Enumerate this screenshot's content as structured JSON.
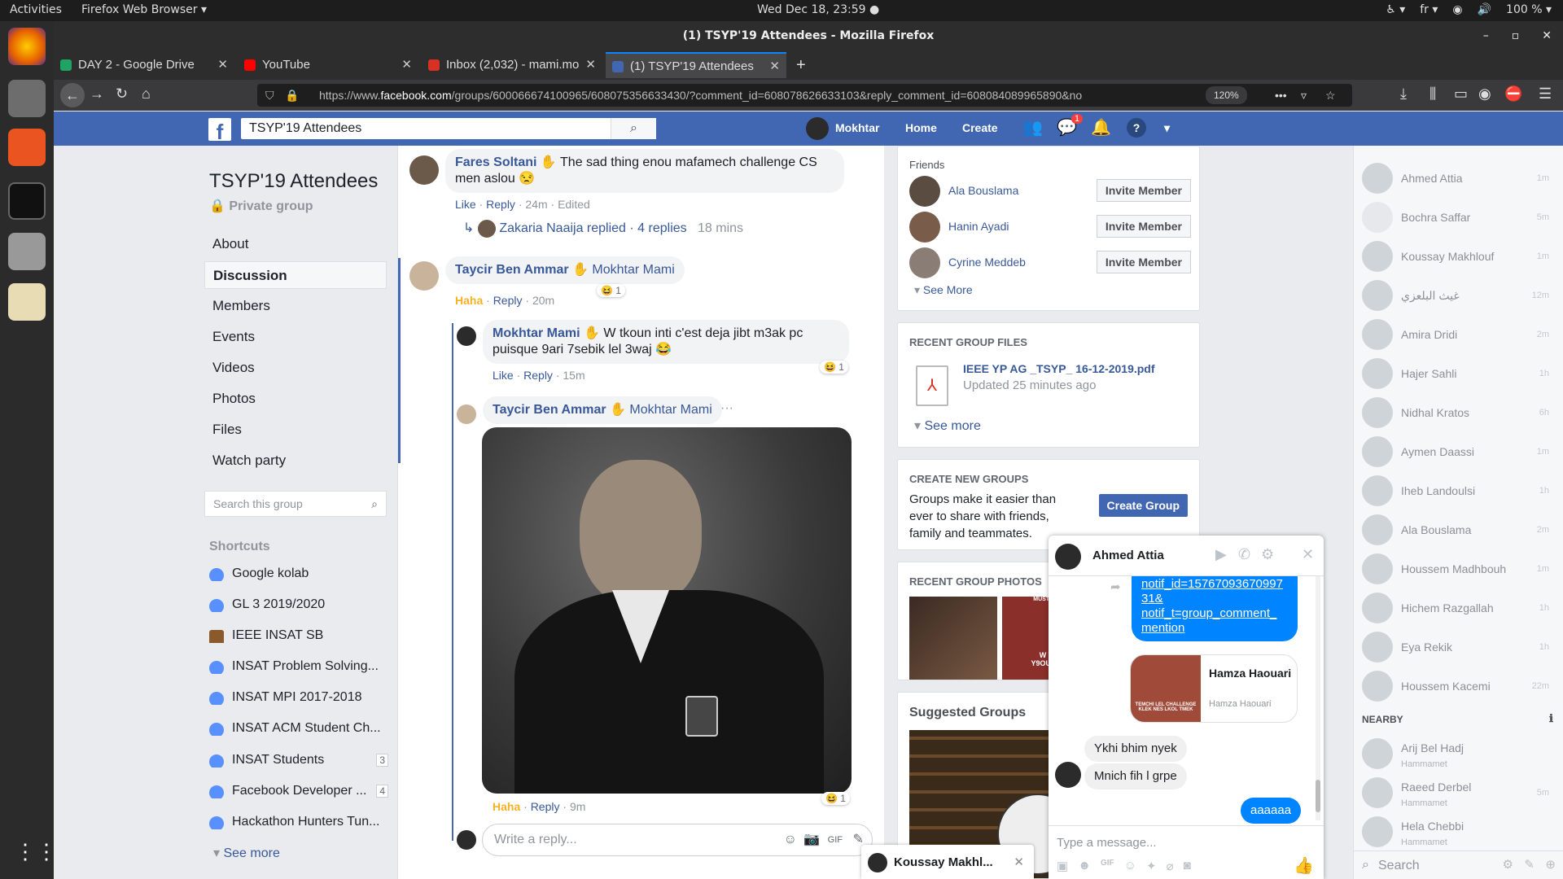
{
  "os": {
    "activities": "Activities",
    "app_menu": "Firefox Web Browser ▾",
    "clock": "Wed Dec 18, 23:59 ●",
    "lang": "fr ▾",
    "battery": "100 % ▾"
  },
  "window": {
    "title": "(1) TSYP'19 Attendees - Mozilla Firefox"
  },
  "tabs": [
    {
      "label": "DAY 2 - Google Drive",
      "color": "#1fa463"
    },
    {
      "label": "YouTube",
      "color": "#ff0000"
    },
    {
      "label": "Inbox (2,032) - mami.mo",
      "color": "#d93025"
    },
    {
      "label": "(1) TSYP'19 Attendees",
      "color": "#4267b2"
    }
  ],
  "nav": {
    "url_prefix": "https://www.",
    "url_domain": "facebook.com",
    "url_rest": "/groups/600066674100965/608075356633430/?comment_id=608078626633103&reply_comment_id=608084089965890&no",
    "zoom": "120%"
  },
  "fb": {
    "search_value": "TSYP'19 Attendees",
    "profile": "Mokhtar",
    "home": "Home",
    "create": "Create",
    "msg_badge": "1"
  },
  "group": {
    "title": "TSYP'19 Attendees",
    "privacy": "Private group",
    "nav": [
      "About",
      "Discussion",
      "Members",
      "Events",
      "Videos",
      "Photos",
      "Files",
      "Watch party"
    ],
    "search_placeholder": "Search this group",
    "shortcuts_title": "Shortcuts",
    "shortcuts": [
      {
        "label": "Google kolab",
        "count": ""
      },
      {
        "label": "GL 3 2019/2020",
        "count": ""
      },
      {
        "label": "IEEE INSAT SB",
        "count": ""
      },
      {
        "label": "INSAT Problem Solving...",
        "count": ""
      },
      {
        "label": "INSAT MPI 2017-2018",
        "count": ""
      },
      {
        "label": "INSAT ACM Student Ch...",
        "count": ""
      },
      {
        "label": "INSAT Students",
        "count": "3"
      },
      {
        "label": "Facebook Developer ...",
        "count": "4"
      },
      {
        "label": "Hackathon Hunters Tun...",
        "count": ""
      }
    ],
    "see_more": "See more"
  },
  "feed": {
    "c1": {
      "name": "Fares Soltani",
      "text": "The sad thing enou mafamech challenge CS men aslou 😒",
      "like": "Like",
      "reply": "Reply",
      "time": "24m",
      "edited": "Edited"
    },
    "c1_replies": {
      "name": "Zakaria Naaija replied",
      "count": "4 replies",
      "time": "18 mins"
    },
    "c2": {
      "name": "Taycir Ben Ammar",
      "mention": "Mokhtar Mami",
      "reaction": "Haha",
      "reply": "Reply",
      "time": "20m",
      "rx": "1"
    },
    "r1": {
      "name": "Mokhtar Mami",
      "text": "W tkoun inti c'est deja jibt m3ak pc puisque 9ari 7sebik lel 3waj 😂",
      "like": "Like",
      "reply": "Reply",
      "time": "15m",
      "rx": "1"
    },
    "r2": {
      "name": "Taycir Ben Ammar",
      "mention": "Mokhtar Mami",
      "dots": "···",
      "reaction": "Haha",
      "reply": "Reply",
      "time": "9m",
      "rx": "1"
    },
    "reply_placeholder": "Write a reply..."
  },
  "right": {
    "friends_title": "Friends",
    "friends": [
      "Ala Bouslama",
      "Hanin Ayadi",
      "Cyrine Meddeb"
    ],
    "invite": "Invite Member",
    "see_more": "See More",
    "files_title": "RECENT GROUP FILES",
    "file_name": "IEEE YP AG _TSYP_ 16-12-2019.pdf",
    "file_updated": "Updated 25 minutes ago",
    "files_more": "See more",
    "create_title": "CREATE NEW GROUPS",
    "create_text": "Groups make it easier than ever to share with friends, family and teammates.",
    "create_btn": "Create Group",
    "photos_title": "RECENT GROUP PHOTOS",
    "photo_caption1": "MUSTIEU",
    "photo_caption2": "W T",
    "photo_caption3": "Y9OULO",
    "suggested_title": "Suggested Groups"
  },
  "chatlist": {
    "people": [
      {
        "name": "Ahmed Attia",
        "time": "1m"
      },
      {
        "name": "Bochra Saffar",
        "time": "5m"
      },
      {
        "name": "Koussay Makhlouf",
        "time": "1m"
      },
      {
        "name": "غيث البلعزي",
        "time": "12m"
      },
      {
        "name": "Amira Dridi",
        "time": "2m"
      },
      {
        "name": "Hajer Sahli",
        "time": "1h"
      },
      {
        "name": "Nidhal Kratos",
        "time": "6h"
      },
      {
        "name": "Aymen Daassi",
        "time": "1m"
      },
      {
        "name": "Iheb Landoulsi",
        "time": "1h"
      },
      {
        "name": "Ala Bouslama",
        "time": "2m"
      },
      {
        "name": "Houssem Madhbouh",
        "time": "1m"
      },
      {
        "name": "Hichem Razgallah",
        "time": "1h"
      },
      {
        "name": "Eya Rekik",
        "time": "1h"
      },
      {
        "name": "Houssem Kacemi",
        "time": "22m"
      }
    ],
    "nearby_title": "NEARBY",
    "nearby": [
      {
        "name": "Arij Bel Hadj",
        "sub": "Hammamet",
        "time": ""
      },
      {
        "name": "Raeed Derbel",
        "sub": "Hammamet",
        "time": "5m"
      },
      {
        "name": "Hela Chebbi",
        "sub": "Hammamet",
        "time": ""
      }
    ],
    "search": "Search"
  },
  "chat": {
    "name": "Ahmed Attia",
    "link_lines": [
      "notif_id=15767093670997",
      "31&",
      "notif_t=group_comment_",
      "mention"
    ],
    "card_name": "Hamza Haouari",
    "card_sub": "Hamza Haouari",
    "card_img1": "TEMCHI LEL CHALLENGE",
    "card_img2": "KLEK NES LKOL TMEK",
    "m1": "Ykhi bhim nyek",
    "m2": "Mnich fih l grpe",
    "m3": "aaaaaa",
    "input": "Type a message..."
  },
  "minichat": {
    "name": "Koussay Makhl..."
  }
}
